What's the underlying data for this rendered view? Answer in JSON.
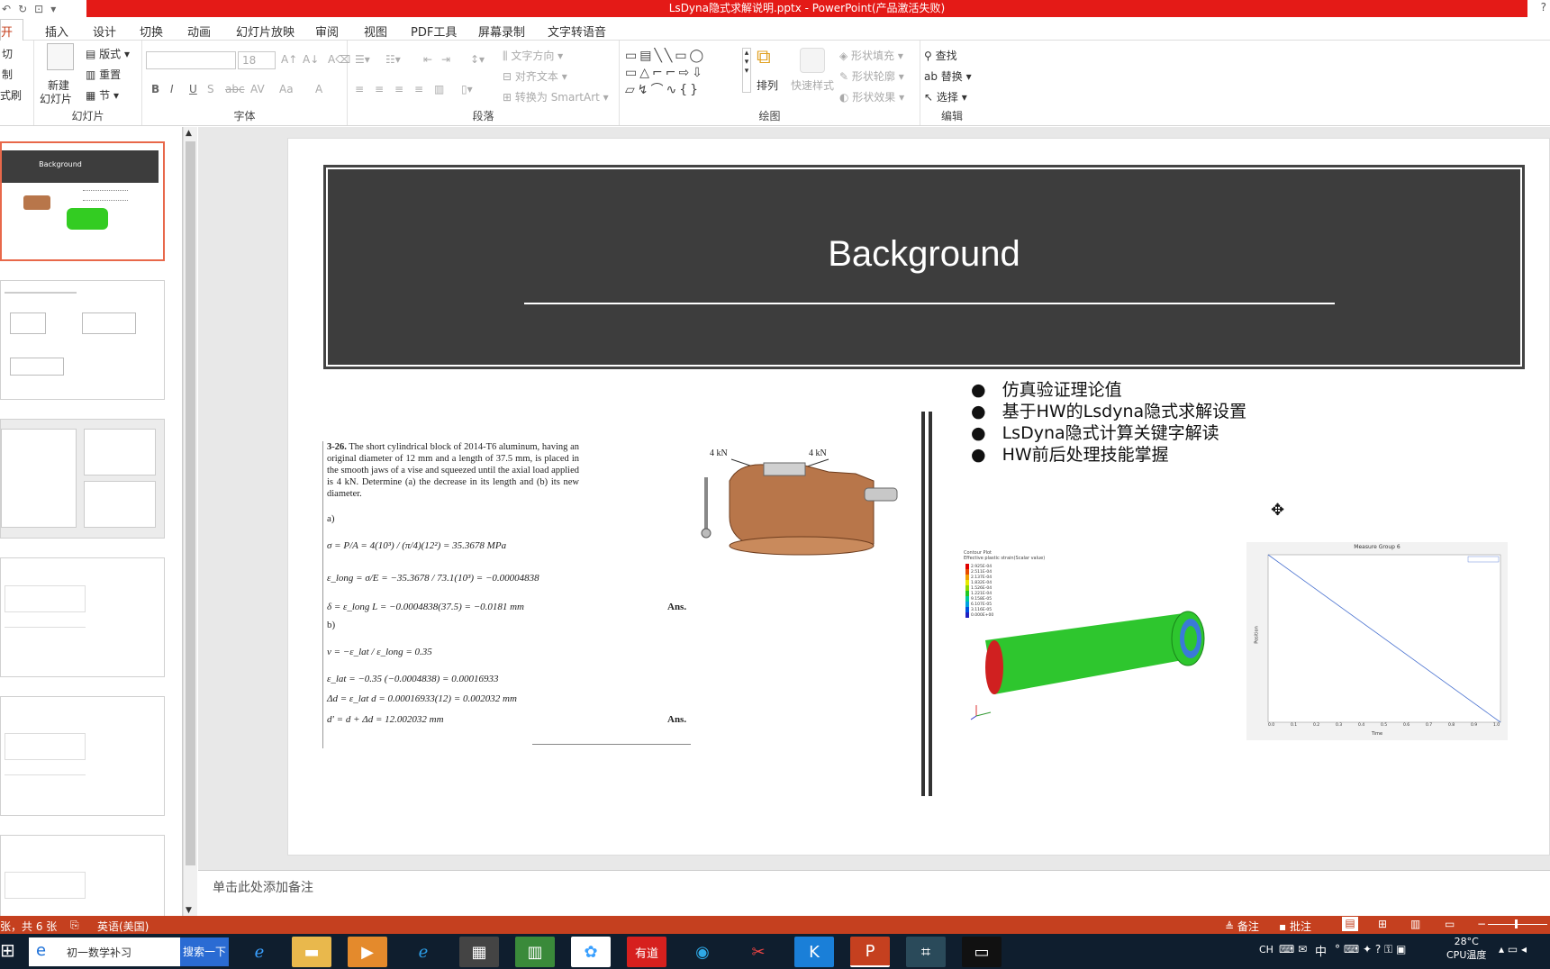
{
  "window": {
    "title": "LsDyna隐式求解说明.pptx - PowerPoint(产品激活失败)",
    "help": "?"
  },
  "tabs": [
    "开始",
    "插入",
    "设计",
    "切换",
    "动画",
    "幻灯片放映",
    "审阅",
    "视图",
    "PDF工具",
    "屏幕录制",
    "文字转语音"
  ],
  "ribbon": {
    "clipboard": {
      "cut": "切",
      "copy": "制",
      "format_painter": "式刷"
    },
    "slides": {
      "new_slide": "新建",
      "new_slide2": "幻灯片",
      "layout": "版式",
      "reset": "重置",
      "section": "节",
      "label": "幻灯片"
    },
    "font": {
      "size": "18",
      "label": "字体",
      "bold": "B",
      "italic": "I",
      "underline": "U",
      "shadow": "S",
      "strike": "abc",
      "spacing": "AV",
      "case": "Aa",
      "color": "A"
    },
    "paragraph": {
      "text_direction": "文字方向",
      "align_text": "对齐文本",
      "smartart": "转换为 SmartArt",
      "label": "段落"
    },
    "drawing": {
      "arrange": "排列",
      "quick_styles": "快速样式",
      "shape_fill": "形状填充",
      "shape_outline": "形状轮廓",
      "shape_effects": "形状效果",
      "label": "绘图"
    },
    "editing": {
      "find": "查找",
      "replace": "替换",
      "select": "选择",
      "label": "编辑"
    }
  },
  "slide": {
    "title": "Background",
    "bullets": [
      "仿真验证理论值",
      "基于HW的Lsdyna隐式求解设置",
      "LsDyna隐式计算关键字解读",
      "HW前后处理技能掌握"
    ],
    "problem": {
      "number": "3-26.",
      "text": "The short cylindrical block of 2014-T6 aluminum, having an original diameter of 12 mm and a length of 37.5 mm, is placed in the smooth jaws of a vise and squeezed until the axial load applied is 4 kN. Determine (a) the decrease in its length and (b) its new diameter.",
      "force_left": "4 kN",
      "force_right": "4 kN",
      "part_a": "a)",
      "eq1": "σ = P/A = 4(10³) / (π/4)(12²) = 35.3678 MPa",
      "eq2": "ε_long = σ/E = −35.3678 / 73.1(10³) = −0.00004838",
      "eq3": "δ = ε_long L = −0.0004838(37.5) = −0.0181 mm",
      "ans1": "Ans.",
      "part_b": "b)",
      "eq4": "ν = −ε_lat / ε_long = 0.35",
      "eq5": "ε_lat = −0.35 (−0.0004838) = 0.00016933",
      "eq6": "Δd = ε_lat d = 0.00016933(12) = 0.002032 mm",
      "eq7": "d′ = d + Δd = 12.002032 mm",
      "ans2": "Ans."
    },
    "contour": {
      "title": "Contour Plot",
      "subtitle": "Effective plastic strain(Scalar value)",
      "levels": [
        "2.925E-04",
        "2.511E-04",
        "2.137E-04",
        "1.832E-04",
        "1.526E-04",
        "1.221E-04",
        "9.158E-05",
        "6.107E-05",
        "3.116E-05",
        "0.000E+00"
      ],
      "colors": [
        "#e00000",
        "#e84b00",
        "#f0a000",
        "#e8e800",
        "#8cd800",
        "#22c822",
        "#00c8a0",
        "#00a0e0",
        "#0050e0",
        "#2020c0"
      ]
    },
    "measure": {
      "title": "Measure Group 6",
      "ylabel": "Position",
      "xlabel": "Time",
      "xticks": [
        "0.0",
        "0.1",
        "0.2",
        "0.3",
        "0.4",
        "0.5",
        "0.6",
        "0.7",
        "0.8",
        "0.9",
        "1.0"
      ]
    }
  },
  "notes": {
    "placeholder": "单击此处添加备注"
  },
  "statusbar": {
    "slide_info": "张，共 6 张",
    "language": "英语(美国)",
    "notes": "备注",
    "comments": "批注"
  },
  "taskbar": {
    "search_text": "初一数学补习",
    "search_button": "搜索一下",
    "youdao": "有道",
    "tray_lang": "CH",
    "ime": "中",
    "temp": "28°C",
    "cpu": "CPU温度"
  }
}
